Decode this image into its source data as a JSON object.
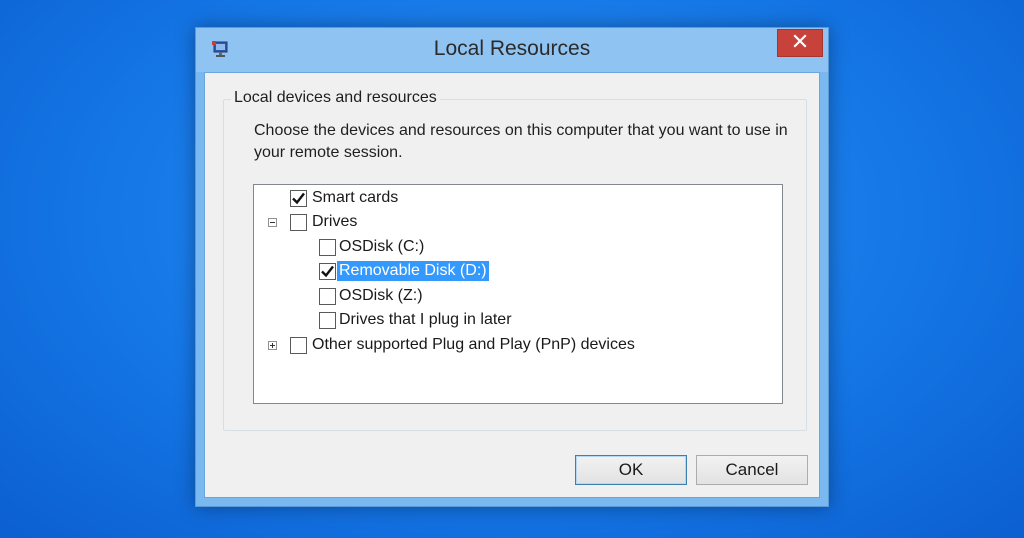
{
  "dialog": {
    "title": "Local Resources",
    "app_icon": "remote-desktop-icon",
    "close_icon": "close-icon"
  },
  "group": {
    "legend": "Local devices and resources",
    "description": "Choose the devices and resources on this computer that you want to use in your remote session."
  },
  "tree": {
    "items": [
      {
        "label": "Smart cards",
        "checked": true,
        "level": 0,
        "expander": "none"
      },
      {
        "label": "Drives",
        "checked": false,
        "level": 0,
        "expander": "minus"
      },
      {
        "label": "OSDisk (C:)",
        "checked": false,
        "level": 1,
        "expander": "none"
      },
      {
        "label": "Removable Disk (D:)",
        "checked": true,
        "level": 1,
        "expander": "none",
        "selected": true
      },
      {
        "label": "OSDisk (Z:)",
        "checked": false,
        "level": 1,
        "expander": "none"
      },
      {
        "label": "Drives that I plug in later",
        "checked": false,
        "level": 1,
        "expander": "none"
      },
      {
        "label": "Other supported Plug and Play (PnP) devices",
        "checked": false,
        "level": 0,
        "expander": "plus"
      }
    ]
  },
  "buttons": {
    "ok": "OK",
    "cancel": "Cancel"
  },
  "colors": {
    "desktop": "#1577e6",
    "titlebar": "#8fc3f2",
    "close": "#c7423a",
    "selection": "#3399ff"
  }
}
